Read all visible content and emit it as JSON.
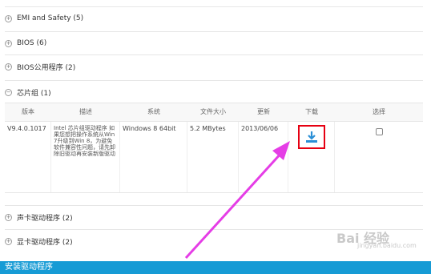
{
  "categories": [
    {
      "label": "EMI and Safety (5)",
      "toggle": "+"
    },
    {
      "label": "BIOS (6)",
      "toggle": "+"
    },
    {
      "label": "BIOS公用程序 (2)",
      "toggle": "+"
    },
    {
      "label": "芯片组 (1)",
      "toggle": "−"
    }
  ],
  "table": {
    "headers": [
      "版本",
      "描述",
      "系统",
      "文件大小",
      "更新",
      "下载",
      "选择"
    ],
    "row": {
      "version": "V9.4.0.1017",
      "description": "Intel 芯片组驱动程序 如果您想把操作系统从Win 7升级到Win 8，为避免软件兼容性问题，请先卸除旧驱动再安装新版驱动",
      "system": "Windows 8 64bit",
      "size": "5.2 MBytes",
      "date": "2013/06/06"
    }
  },
  "more_categories": [
    {
      "label": "声卡驱动程序 (2)",
      "toggle": "+"
    },
    {
      "label": "显卡驱动程序 (2)",
      "toggle": "+"
    }
  ],
  "bottom_bar": "安装驱动程序",
  "watermark": "Bai 经验",
  "watermark_url": "jingyan.baidu.com",
  "colors": {
    "accent": "#169bd5",
    "highlight": "#e60012",
    "arrow": "#e53de6",
    "download_icon": "#2a8fd6"
  }
}
